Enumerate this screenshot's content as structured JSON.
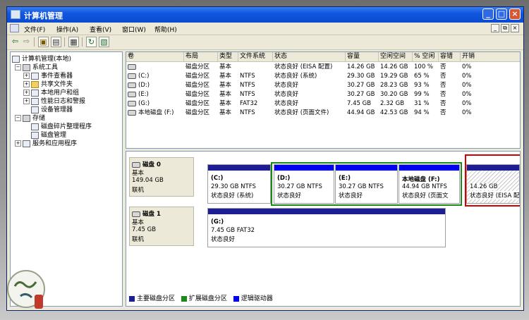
{
  "window": {
    "title": "计算机管理"
  },
  "menu": [
    "文件(F)",
    "操作(A)",
    "查看(V)",
    "窗口(W)",
    "帮助(H)"
  ],
  "mdi_controls": [
    "_",
    "⧉",
    "×"
  ],
  "tree": {
    "root": "计算机管理(本地)",
    "system_tools": "系统工具",
    "event_viewer": "事件查看器",
    "shared_folders": "共享文件夹",
    "local_users": "本地用户和组",
    "perf_logs": "性能日志和警报",
    "device_manager": "设备管理器",
    "storage": "存储",
    "defrag": "磁盘碎片整理程序",
    "disk_mgmt": "磁盘管理",
    "services": "服务和应用程序"
  },
  "columns": [
    "卷",
    "布局",
    "类型",
    "文件系统",
    "状态",
    "容量",
    "空闲空间",
    "% 空闲",
    "容错",
    "开销"
  ],
  "volumes": [
    [
      "",
      "磁盘分区",
      "基本",
      "",
      "状态良好 (EISA 配置)",
      "14.26 GB",
      "14.26 GB",
      "100 %",
      "否",
      "0%"
    ],
    [
      "(C:)",
      "磁盘分区",
      "基本",
      "NTFS",
      "状态良好 (系统)",
      "29.30 GB",
      "19.29 GB",
      "65 %",
      "否",
      "0%"
    ],
    [
      "(D:)",
      "磁盘分区",
      "基本",
      "NTFS",
      "状态良好",
      "30.27 GB",
      "28.23 GB",
      "93 %",
      "否",
      "0%"
    ],
    [
      "(E:)",
      "磁盘分区",
      "基本",
      "NTFS",
      "状态良好",
      "30.27 GB",
      "30.20 GB",
      "99 %",
      "否",
      "0%"
    ],
    [
      "(G:)",
      "磁盘分区",
      "基本",
      "FAT32",
      "状态良好",
      "7.45 GB",
      "2.32 GB",
      "31 %",
      "否",
      "0%"
    ],
    [
      "本地磁盘 (F:)",
      "磁盘分区",
      "基本",
      "NTFS",
      "状态良好 (页面文件)",
      "44.94 GB",
      "42.53 GB",
      "94 %",
      "否",
      "0%"
    ]
  ],
  "disk0": {
    "label": "磁盘 0",
    "type": "基本",
    "size": "149.04 GB",
    "status": "联机",
    "vols": [
      {
        "name": "(C:)",
        "size": "29.30 GB NTFS",
        "status": "状态良好 (系统)"
      },
      {
        "name": "(D:)",
        "size": "30.27 GB NTFS",
        "status": "状态良好"
      },
      {
        "name": "(E:)",
        "size": "30.27 GB NTFS",
        "status": "状态良好"
      },
      {
        "name": "本地磁盘  (F:)",
        "size": "44.94 GB NTFS",
        "status": "状态良好 (页面文"
      },
      {
        "name": "",
        "size": "14.26 GB",
        "status": "状态良好 (EISA 配"
      }
    ]
  },
  "disk1": {
    "label": "磁盘 1",
    "type": "基本",
    "size": "7.45 GB",
    "status": "联机",
    "vols": [
      {
        "name": "(G:)",
        "size": "7.45 GB FAT32",
        "status": "状态良好"
      }
    ]
  },
  "legend": [
    "主要磁盘分区",
    "扩展磁盘分区",
    "逻辑驱动器"
  ],
  "colors": {
    "primary": "#1e1e94",
    "extended": "#1b8a1b",
    "logical": "#0000f0",
    "highlight": "#d40000"
  }
}
